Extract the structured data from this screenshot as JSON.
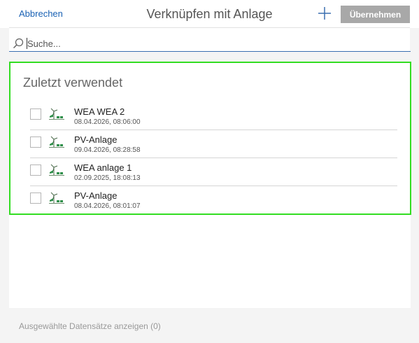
{
  "header": {
    "cancel_label": "Abbrechen",
    "title": "Verknüpfen mit Anlage",
    "apply_label": "Übernehmen"
  },
  "search": {
    "placeholder": "Suche...",
    "value": ""
  },
  "recent": {
    "title": "Zuletzt verwendet",
    "items": [
      {
        "name": "WEA WEA 2",
        "date": "08.04.2026, 08:06:00",
        "checked": false,
        "icon": "plant-icon"
      },
      {
        "name": "PV-Anlage",
        "date": "09.04.2026, 08:28:58",
        "checked": false,
        "icon": "plant-icon"
      },
      {
        "name": "WEA anlage 1",
        "date": "02.09.2025, 18:08:13",
        "checked": false,
        "icon": "plant-icon"
      },
      {
        "name": "PV-Anlage",
        "date": "08.04.2026, 08:01:07",
        "checked": false,
        "icon": "plant-icon"
      }
    ]
  },
  "footer": {
    "show_selected_label": "Ausgewählte Datensätze anzeigen (0)"
  },
  "colors": {
    "link": "#1a62b4",
    "highlight_border": "#33dd22",
    "apply_button": "#a8a8a8"
  }
}
